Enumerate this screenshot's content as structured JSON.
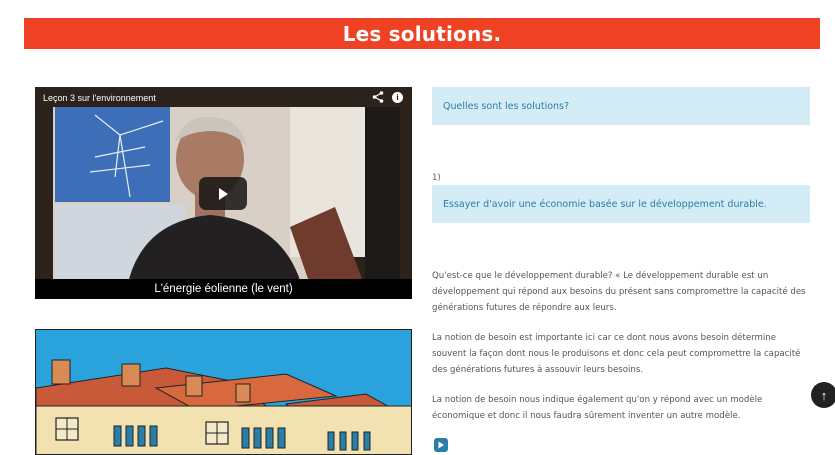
{
  "banner": {
    "title": "Les solutions."
  },
  "video": {
    "title": "Leçon 3 sur l'environnement",
    "caption": "L'énergie éolienne (le vent)",
    "share_icon": "share-icon",
    "info_icon": "info-icon",
    "info_glyph": "i",
    "play_icon": "play-icon"
  },
  "content": {
    "question_1": "Quelles sont les solutions?",
    "number_1": "1)",
    "solution_1": "Essayer d'avoir une économie basée sur le développement durable.",
    "paragraph_1": "Qu'est-ce que le développement durable? « Le développement durable est un développement qui répond aux besoins du présent sans compromettre la capacité des générations futures de répondre aux leurs.",
    "paragraph_2": "La notion de besoin est importante ici car ce dont nous avons besoin détermine souvent la façon dont nous le produisons et donc cela peut compromettre la capacité des générations futures à assouvir leurs besoins.",
    "paragraph_3": "La notion de besoin nous indique également qu'on y répond avec un modèle économique et donc il nous faudra sûrement inventer un autre modèle."
  },
  "controls": {
    "scroll_top_icon": "arrow-up-icon",
    "scroll_top_glyph": "↑",
    "mini_play_icon": "play-icon"
  },
  "colors": {
    "banner": "#ef4123",
    "question_box": "#d4ecf5",
    "link_text": "#2a7ea8",
    "sky": "#2aa3dc",
    "roof": "#c85a3a",
    "facade": "#f2e2b2"
  }
}
